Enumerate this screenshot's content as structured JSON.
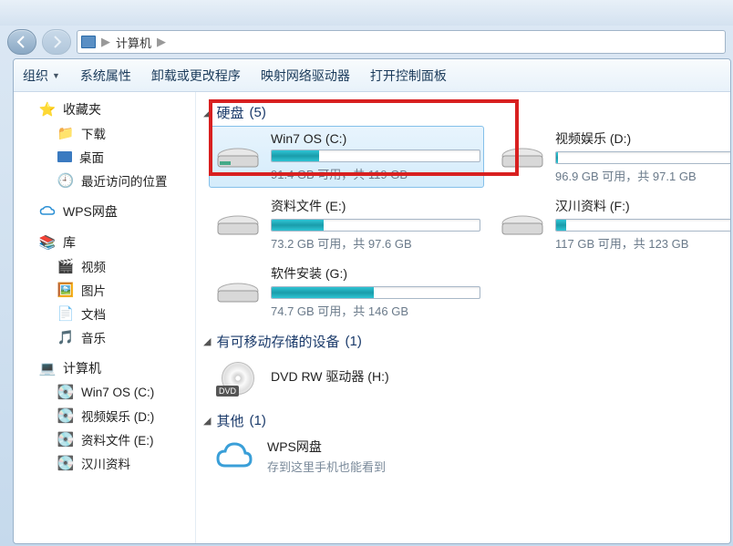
{
  "addressbar": {
    "location": "计算机"
  },
  "toolbar": {
    "organize": "组织",
    "properties": "系统属性",
    "uninstall": "卸载或更改程序",
    "network": "映射网络驱动器",
    "controlpanel": "打开控制面板"
  },
  "sidebar": {
    "favorites": {
      "label": "收藏夹",
      "downloads": "下载",
      "desktop": "桌面",
      "recent": "最近访问的位置"
    },
    "wps": {
      "label": "WPS网盘"
    },
    "libraries": {
      "label": "库",
      "videos": "视频",
      "pictures": "图片",
      "documents": "文档",
      "music": "音乐"
    },
    "computer": {
      "label": "计算机",
      "c": "Win7 OS (C:)",
      "d": "视频娱乐 (D:)",
      "e": "资料文件 (E:)",
      "f": "汉川资料"
    }
  },
  "sections": {
    "hdd": {
      "label": "硬盘",
      "count": "(5)"
    },
    "removable": {
      "label": "有可移动存储的设备",
      "count": "(1)"
    },
    "other": {
      "label": "其他",
      "count": "(1)"
    }
  },
  "drives": {
    "c": {
      "name": "Win7 OS (C:)",
      "stats": "91.4 GB 可用，共 119 GB",
      "fill": 23
    },
    "d": {
      "name": "视频娱乐 (D:)",
      "stats": "96.9 GB 可用，共 97.1 GB",
      "fill": 1
    },
    "e": {
      "name": "资料文件 (E:)",
      "stats": "73.2 GB 可用，共 97.6 GB",
      "fill": 25
    },
    "f": {
      "name": "汉川资料 (F:)",
      "stats": "117 GB 可用，共 123 GB",
      "fill": 5
    },
    "g": {
      "name": "软件安装 (G:)",
      "stats": "74.7 GB 可用，共 146 GB",
      "fill": 49
    }
  },
  "dvd": {
    "name": "DVD RW 驱动器 (H:)"
  },
  "other": {
    "title": "WPS网盘",
    "subtitle": "存到这里手机也能看到"
  }
}
